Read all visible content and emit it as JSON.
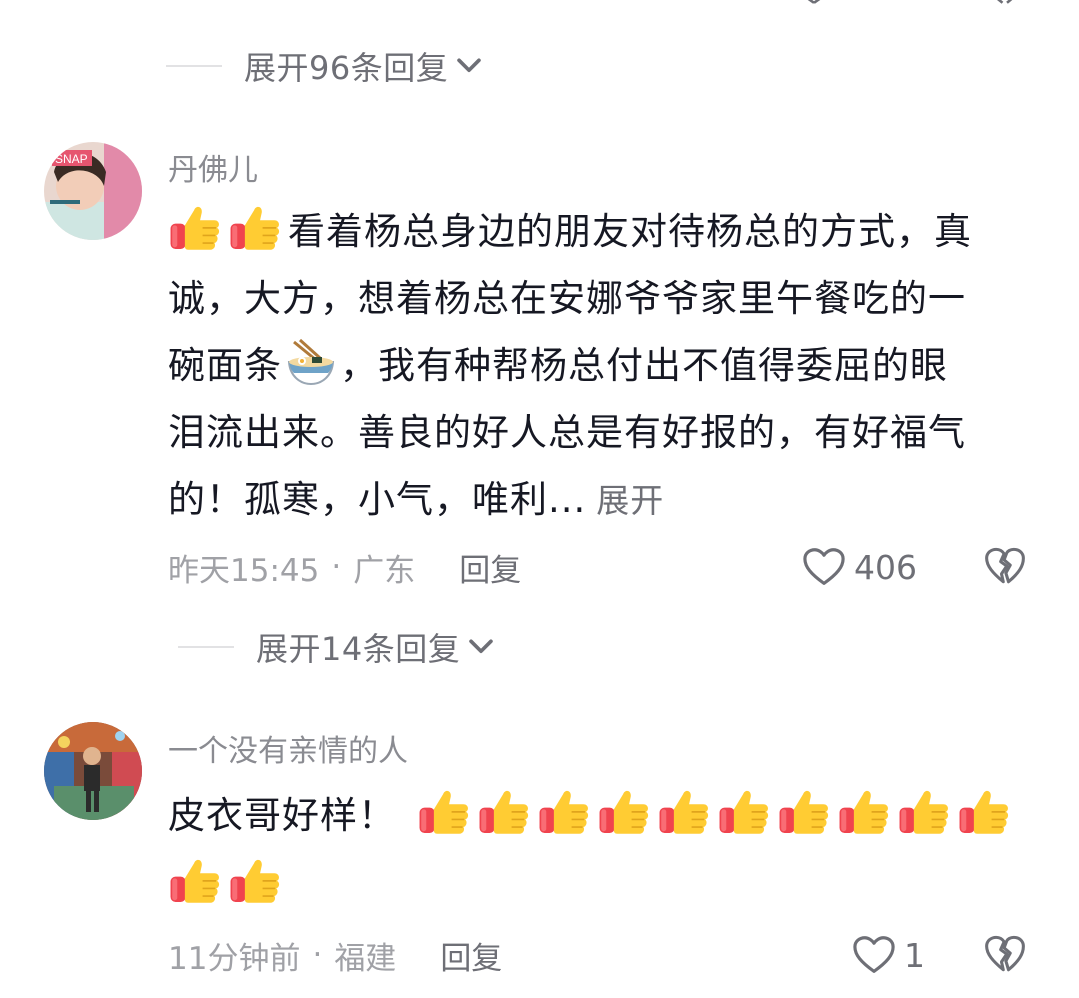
{
  "top_expand": {
    "label": "展开96条回复"
  },
  "comments": [
    {
      "username": "丹佛儿",
      "text_line1": "看着杨总身边的朋友对待杨总的方式，真",
      "text_line2": "诚，大方，想着杨总在安娜爷爷家里午餐吃的一",
      "text_line3a": "碗面条",
      "text_line3b": "，我有种帮杨总付出不值得委屈的眼",
      "text_line4": "泪流出来。善良的好人总是有好报的，有好福气",
      "text_line5": "的！孤寒，小气，唯利...",
      "more_label": "展开",
      "time": "昨天15:45",
      "location": "广东",
      "reply_label": "回复",
      "likes": "406",
      "avatar_text": "SNAP",
      "replies_expand": "展开14条回复"
    },
    {
      "username": "一个没有亲情的人",
      "text": "皮衣哥好样！",
      "time": "11分钟前",
      "location": "福建",
      "reply_label": "回复",
      "likes": "1"
    }
  ],
  "separator_dot": "·",
  "colors": {
    "text_primary": "#161823",
    "text_secondary": "#8a8b91",
    "text_meta": "#a0a1a6",
    "thumb_yellow": "#ffcc33",
    "thumb_cuff": "#f0434e"
  },
  "icons": [
    "thumbs-up-icon",
    "noodle-bowl-icon",
    "heart-outline-icon",
    "broken-heart-icon",
    "chevron-down-icon"
  ]
}
